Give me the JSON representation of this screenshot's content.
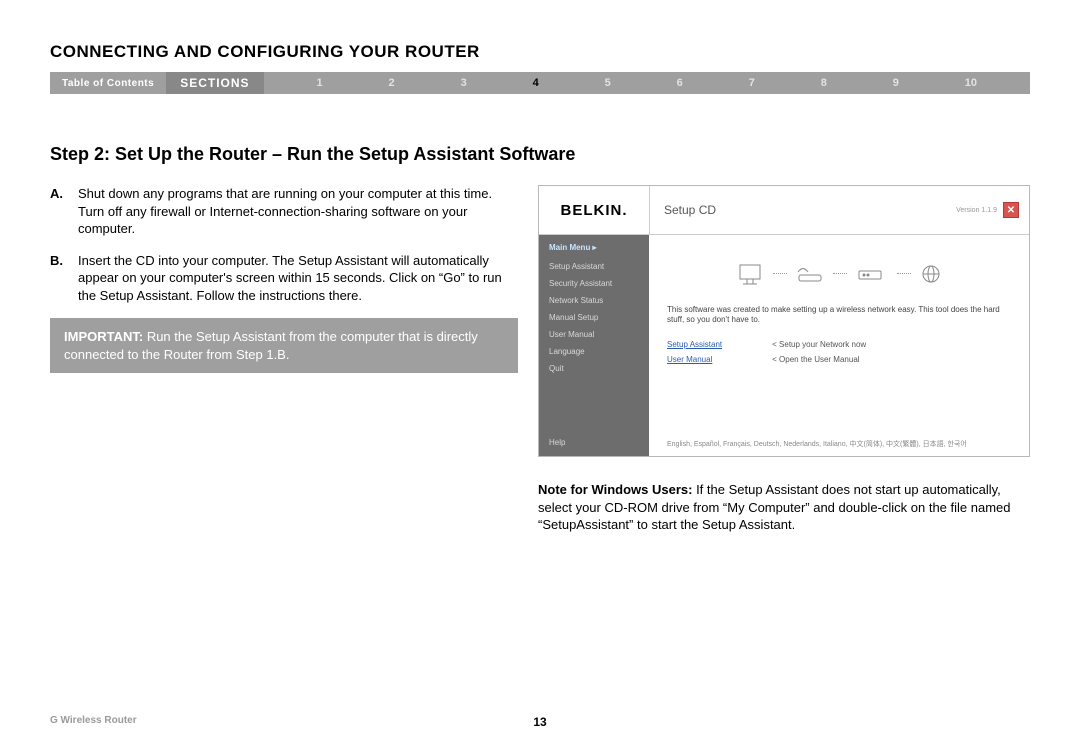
{
  "header": {
    "title": "CONNECTING AND CONFIGURING YOUR ROUTER",
    "toc": "Table of Contents",
    "sections_label": "SECTIONS",
    "sections": [
      "1",
      "2",
      "3",
      "4",
      "5",
      "6",
      "7",
      "8",
      "9",
      "10"
    ],
    "active_section": "4"
  },
  "step": {
    "title": "Step 2: Set Up the Router – Run the Setup Assistant Software",
    "items": [
      {
        "label": "A.",
        "text": "Shut down any programs that are running on your computer at this time. Turn off any firewall or Internet-connection-sharing software on your computer."
      },
      {
        "label": "B.",
        "text": "Insert the CD into your computer. The Setup Assistant will automatically appear on your computer's screen within 15 seconds. Click on “Go” to run the Setup Assistant. Follow the instructions there."
      }
    ],
    "important_label": "IMPORTANT:",
    "important_text": " Run the Setup Assistant from the computer that is directly connected to the Router from Step 1.B."
  },
  "setup_cd": {
    "brand": "BELKIN.",
    "title": "Setup CD",
    "version": "Version 1.1.9",
    "close": "✕",
    "sidebar": {
      "main": "Main Menu  ▸",
      "items": [
        "Setup Assistant",
        "Security Assistant",
        "Network Status",
        "Manual Setup",
        "User Manual",
        "Language",
        "Quit"
      ],
      "help": "Help"
    },
    "description": "This software was created to make setting up a wireless network easy. This tool does the hard stuff, so you don't have to.",
    "links": {
      "col1": [
        "Setup Assistant",
        "User Manual"
      ],
      "col2": [
        "< Setup your Network now",
        "< Open the User Manual"
      ]
    },
    "languages": "English, Español, Français, Deutsch, Nederlands, Italiano, 中文(简体), 中文(繁體), 日本語, 한국어"
  },
  "windows_note": {
    "label": "Note for Windows Users:",
    "text": " If the Setup Assistant does not start up automatically, select your CD-ROM drive from “My Computer” and double-click on the file named “SetupAssistant” to start the Setup Assistant."
  },
  "footer": {
    "model": "G Wireless Router",
    "page": "13"
  }
}
